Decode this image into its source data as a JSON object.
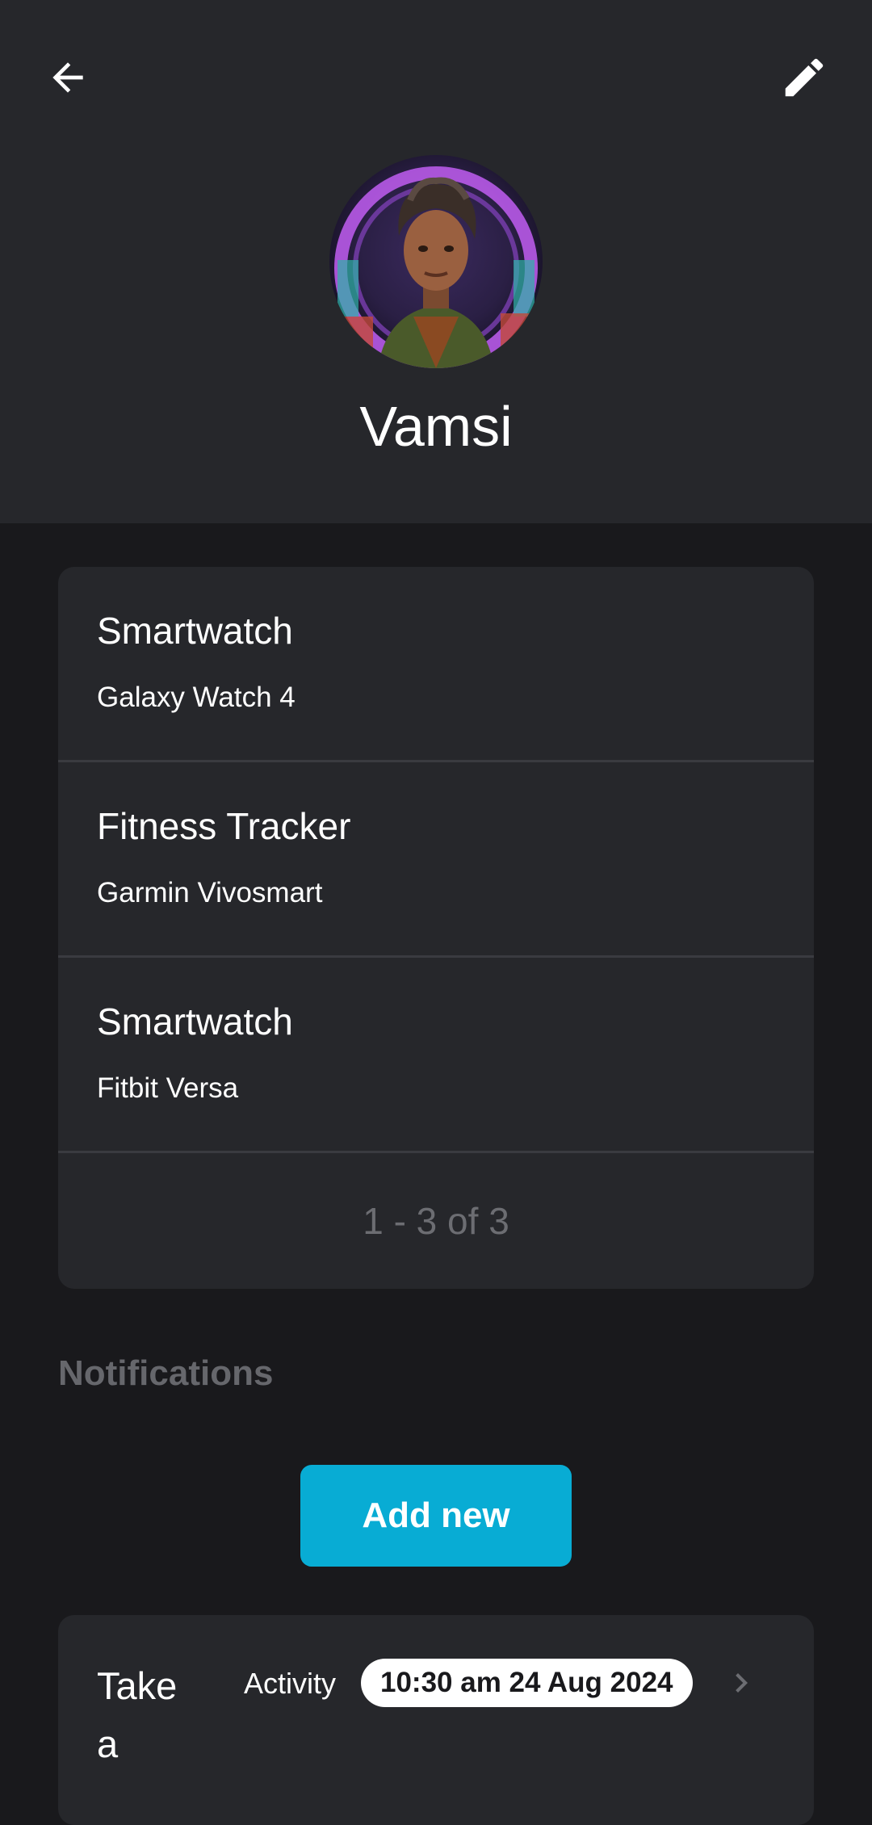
{
  "header": {
    "user_name": "Vamsi",
    "back_icon": "arrow-left-icon",
    "edit_icon": "pencil-icon"
  },
  "devices": {
    "items": [
      {
        "type": "Smartwatch",
        "model": "Galaxy Watch 4"
      },
      {
        "type": "Fitness Tracker",
        "model": "Garmin Vivosmart"
      },
      {
        "type": "Smartwatch",
        "model": "Fitbit Versa"
      }
    ],
    "pagination": "1 - 3 of 3"
  },
  "notifications": {
    "title": "Notifications",
    "add_label": "Add new",
    "items": [
      {
        "title": "Take a",
        "type": "Activity",
        "time": "10:30 am 24 Aug 2024"
      }
    ]
  },
  "colors": {
    "header_bg": "#26272b",
    "page_bg": "#19191c",
    "accent": "#08acd4",
    "muted": "#66676c"
  }
}
